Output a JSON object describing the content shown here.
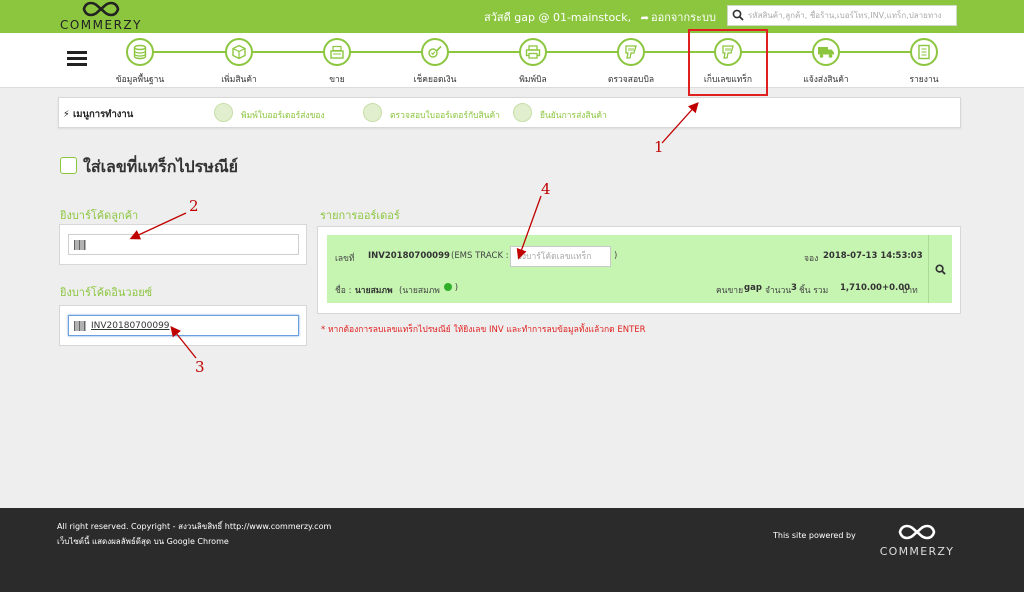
{
  "app": {
    "logo_text": "COMMERZY",
    "greeting": "สวัสดี gap @ 01-mainstock,",
    "logout": "ออกจากระบบ",
    "search_placeholder": "รหัสสินค้า,ลูกค้า, ชื่อร้าน,เบอร์โทร,INV,แทร็ก,ปลายทาง"
  },
  "nav": {
    "items": [
      {
        "label": "ข้อมูลพื้นฐาน",
        "icon": "database-icon"
      },
      {
        "label": "เพิ่มสินค้า",
        "icon": "box-icon"
      },
      {
        "label": "ขาย",
        "icon": "cash-register-icon"
      },
      {
        "label": "เช็คยอดเงิน",
        "icon": "money-check-icon"
      },
      {
        "label": "พิมพ์บิล",
        "icon": "printer-icon"
      },
      {
        "label": "ตรวจสอบบิล",
        "icon": "barcode-scanner-icon"
      },
      {
        "label": "เก็บเลขแทร็ก",
        "icon": "barcode-scanner-icon"
      },
      {
        "label": "แจ้งส่งสินค้า",
        "icon": "truck-icon"
      },
      {
        "label": "รายงาน",
        "icon": "report-icon"
      }
    ],
    "active_index": 6
  },
  "work_menu": {
    "title": "เมนูการทำงาน",
    "items": [
      {
        "label": "พิมพ์ใบออร์เดอร์ส่งของ"
      },
      {
        "label": "ตรวจสอบใบออร์เดอร์กับสินค้า"
      },
      {
        "label": "ยืนยันการส่งสินค้า"
      }
    ]
  },
  "page": {
    "title": "ใส่เลขที่แทร็กไปรษณีย์"
  },
  "left": {
    "customer_barcode_label": "ยิงบาร์โค้ดลูกค้า",
    "customer_barcode_value": "",
    "invoice_barcode_label": "ยิงบาร์โค้ดอินวอยซ์",
    "invoice_barcode_value": "INV20180700099"
  },
  "orders": {
    "section_label": "รายการออร์เดอร์",
    "order": {
      "no_label": "เลขที่",
      "invoice": "INV20180700099",
      "ems_prefix": "(EMS TRACK :",
      "ems_suffix": ")",
      "ems_placeholder": "ยิงบาร์โค้ดเลขแทร็ก",
      "reserve_label": "จอง",
      "datetime": "2018-07-13 14:53:03",
      "name_label": "ชื่อ :",
      "customer": "นายสมภพ",
      "customer_alias": "(นายสมภพ",
      "seller_label": "คนขาย",
      "seller": "gap",
      "qty_label": "จำนวน",
      "qty": "3",
      "qty_unit": "ชิ้น รวม",
      "total": "1,710.00+0.00",
      "currency": "บาท"
    },
    "note": "* หากต้องการลบเลขแทร็กไปรษณีย์ ให้ยิงเลข INV และทำการลบข้อมูลทั้งแล้วกด ENTER"
  },
  "annotations": [
    "1",
    "2",
    "3",
    "4"
  ],
  "footer": {
    "copyright": "All right reserved. Copyright - สงวนลิขสิทธิ์ http://www.commerzy.com",
    "browser_note": "เว็บไซต์นี้ แสดงผลลัพธ์ดีสุด บน Google Chrome",
    "powered_by": "This site powered by",
    "logo_text": "COMMERZY"
  },
  "colors": {
    "brand_green": "#8cc63f",
    "order_bg": "#c6f5b2",
    "highlight_red": "#e02020",
    "footer_bg": "#2b2b2b"
  }
}
